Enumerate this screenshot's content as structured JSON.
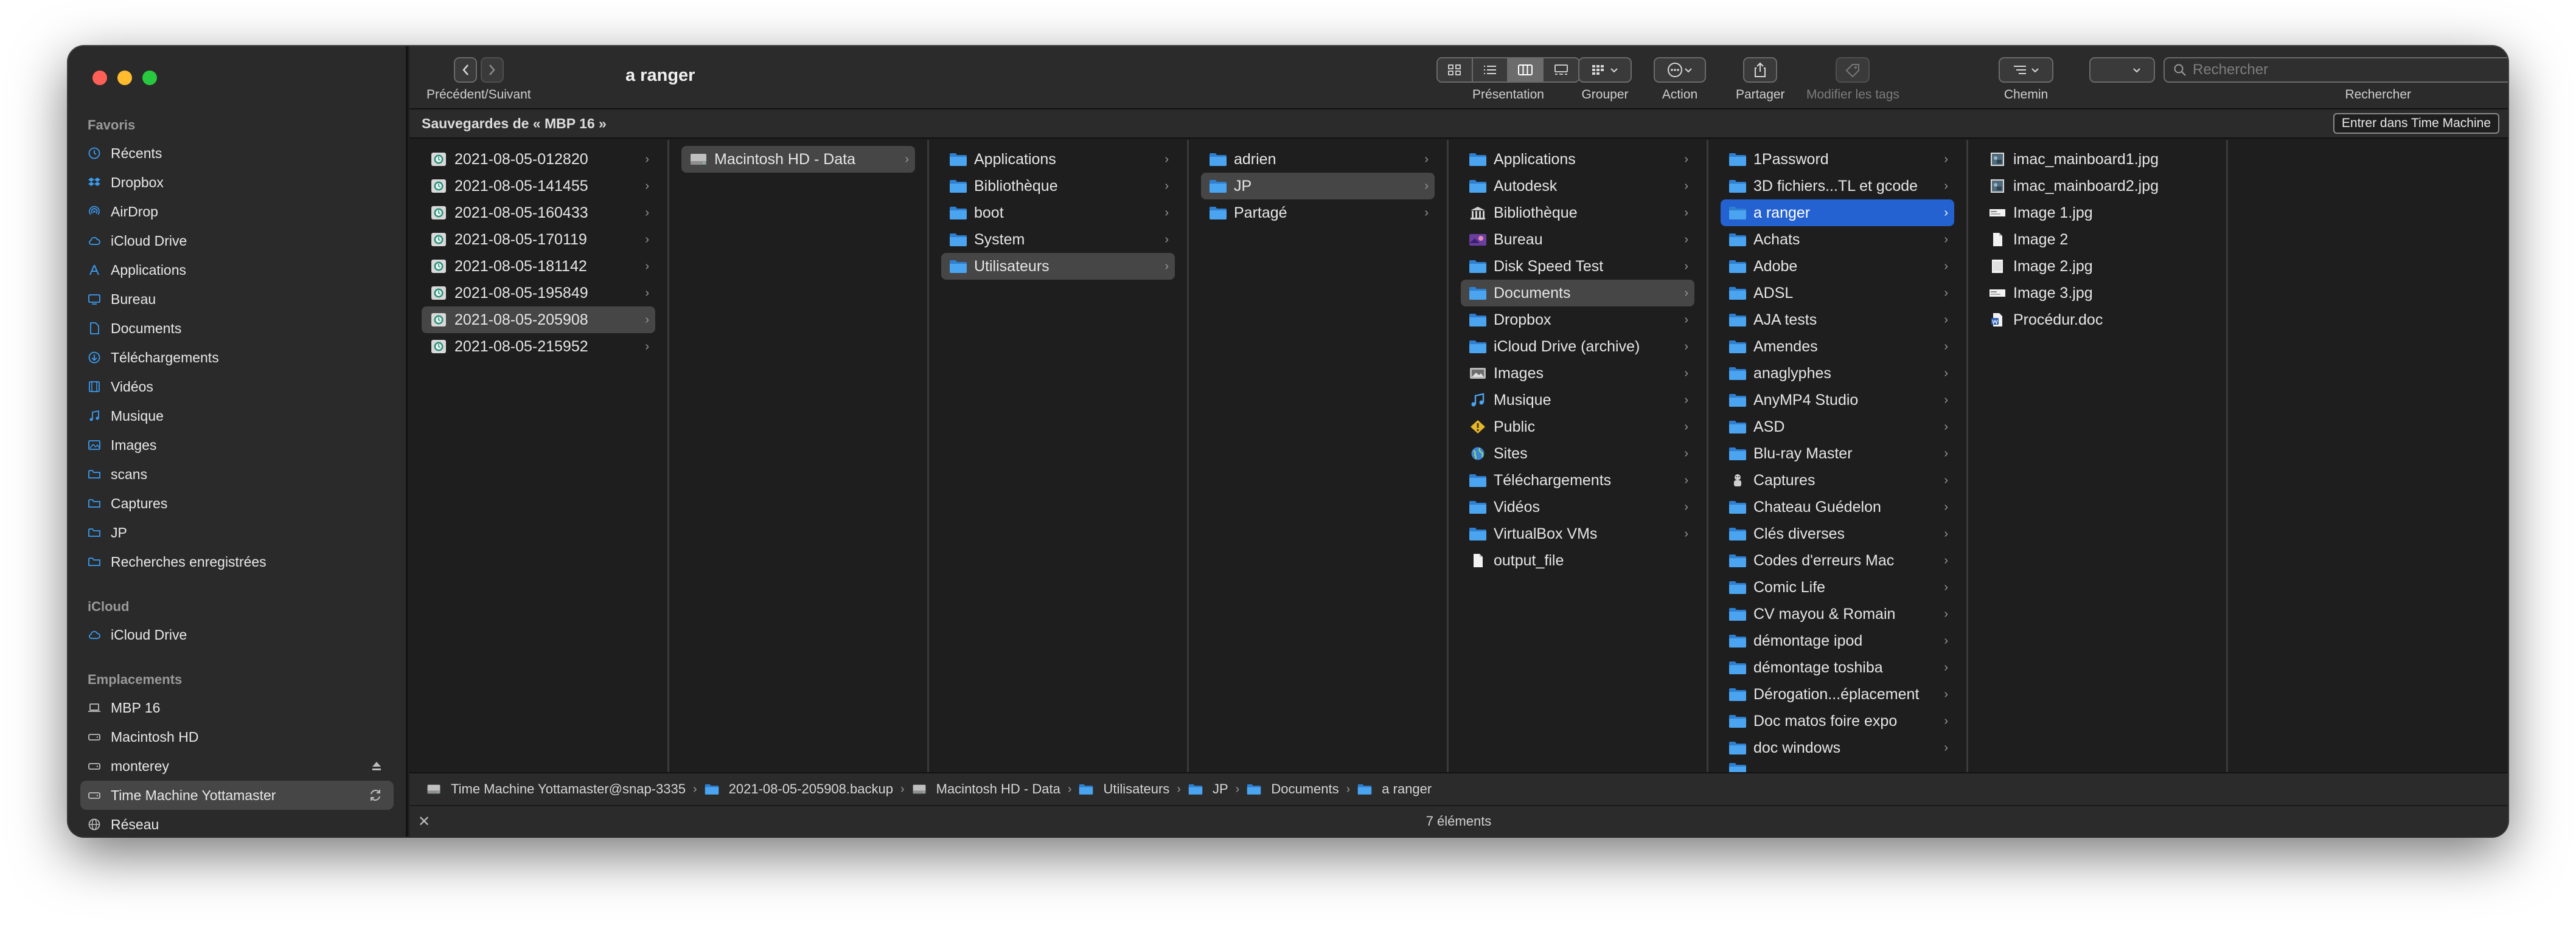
{
  "window": {
    "title": "a ranger"
  },
  "sidebar": {
    "favorites_title": "Favoris",
    "favorites": [
      {
        "label": "Récents",
        "icon": "clock-icon"
      },
      {
        "label": "Dropbox",
        "icon": "dropbox-icon"
      },
      {
        "label": "AirDrop",
        "icon": "airdrop-icon"
      },
      {
        "label": "iCloud Drive",
        "icon": "cloud-icon"
      },
      {
        "label": "Applications",
        "icon": "applications-icon"
      },
      {
        "label": "Bureau",
        "icon": "desktop-icon"
      },
      {
        "label": "Documents",
        "icon": "document-icon"
      },
      {
        "label": "Téléchargements",
        "icon": "download-icon"
      },
      {
        "label": "Vidéos",
        "icon": "film-icon"
      },
      {
        "label": "Musique",
        "icon": "music-icon"
      },
      {
        "label": "Images",
        "icon": "photo-icon"
      },
      {
        "label": "scans",
        "icon": "folder-icon"
      },
      {
        "label": "Captures",
        "icon": "folder-icon"
      },
      {
        "label": "JP",
        "icon": "folder-icon"
      },
      {
        "label": "Recherches enregistrées",
        "icon": "folder-icon"
      }
    ],
    "icloud_title": "iCloud",
    "icloud": [
      {
        "label": "iCloud Drive",
        "icon": "cloud-icon"
      }
    ],
    "locations_title": "Emplacements",
    "locations": [
      {
        "label": "MBP 16",
        "icon": "laptop-icon"
      },
      {
        "label": "Macintosh HD",
        "icon": "drive-icon"
      },
      {
        "label": "monterey",
        "icon": "drive-icon",
        "trail": "eject"
      },
      {
        "label": "Time Machine Yottamaster",
        "icon": "drive-icon",
        "trail": "sync",
        "selected": true
      },
      {
        "label": "Réseau",
        "icon": "globe-icon"
      }
    ]
  },
  "toolbar": {
    "nav_label": "Précédent/Suivant",
    "presentation_label": "Présentation",
    "group_label": "Grouper",
    "action_label": "Action",
    "share_label": "Partager",
    "tags_label": "Modifier les tags",
    "path_label": "Chemin",
    "search_label": "Rechercher",
    "search_placeholder": "Rechercher"
  },
  "backup_bar": {
    "label": "Sauvegardes de « MBP 16 »",
    "enter_button": "Entrer dans Time Machine"
  },
  "columns": [
    [
      {
        "label": "2021-08-05-012820",
        "icon": "tm-backup",
        "chevron": true
      },
      {
        "label": "2021-08-05-141455",
        "icon": "tm-backup",
        "chevron": true
      },
      {
        "label": "2021-08-05-160433",
        "icon": "tm-backup",
        "chevron": true
      },
      {
        "label": "2021-08-05-170119",
        "icon": "tm-backup",
        "chevron": true
      },
      {
        "label": "2021-08-05-181142",
        "icon": "tm-backup",
        "chevron": true
      },
      {
        "label": "2021-08-05-195849",
        "icon": "tm-backup",
        "chevron": true
      },
      {
        "label": "2021-08-05-205908",
        "icon": "tm-backup",
        "chevron": true,
        "sel": "grey"
      },
      {
        "label": "2021-08-05-215952",
        "icon": "tm-backup",
        "chevron": true
      }
    ],
    [
      {
        "label": "Macintosh HD - Data",
        "icon": "disk",
        "chevron": true,
        "sel": "grey"
      }
    ],
    [
      {
        "label": "Applications",
        "icon": "folder",
        "chevron": true
      },
      {
        "label": "Bibliothèque",
        "icon": "folder",
        "chevron": true
      },
      {
        "label": "boot",
        "icon": "folder",
        "chevron": true
      },
      {
        "label": "System",
        "icon": "folder",
        "chevron": true
      },
      {
        "label": "Utilisateurs",
        "icon": "folder",
        "chevron": true,
        "sel": "grey"
      }
    ],
    [
      {
        "label": "adrien",
        "icon": "folder",
        "chevron": true
      },
      {
        "label": "JP",
        "icon": "folder",
        "chevron": true,
        "sel": "grey"
      },
      {
        "label": "Partagé",
        "icon": "folder",
        "chevron": true
      }
    ],
    [
      {
        "label": "Applications",
        "icon": "folder",
        "chevron": true
      },
      {
        "label": "Autodesk",
        "icon": "folder",
        "chevron": true
      },
      {
        "label": "Bibliothèque",
        "icon": "library",
        "chevron": true
      },
      {
        "label": "Bureau",
        "icon": "desktop-folder",
        "chevron": true
      },
      {
        "label": "Disk Speed Test",
        "icon": "folder",
        "chevron": true
      },
      {
        "label": "Documents",
        "icon": "folder",
        "chevron": true,
        "sel": "grey"
      },
      {
        "label": "Dropbox",
        "icon": "folder",
        "chevron": true
      },
      {
        "label": "iCloud Drive (archive)",
        "icon": "folder",
        "chevron": true
      },
      {
        "label": "Images",
        "icon": "images-folder",
        "chevron": true
      },
      {
        "label": "Musique",
        "icon": "music-folder",
        "chevron": true
      },
      {
        "label": "Public",
        "icon": "public",
        "chevron": true
      },
      {
        "label": "Sites",
        "icon": "sites",
        "chevron": true
      },
      {
        "label": "Téléchargements",
        "icon": "folder",
        "chevron": true
      },
      {
        "label": "Vidéos",
        "icon": "folder",
        "chevron": true
      },
      {
        "label": "VirtualBox VMs",
        "icon": "folder",
        "chevron": true
      },
      {
        "label": "output_file",
        "icon": "file",
        "chevron": false
      }
    ],
    [
      {
        "label": "1Password",
        "icon": "folder",
        "chevron": true
      },
      {
        "label": "3D fichiers...TL et gcode",
        "icon": "folder",
        "chevron": true
      },
      {
        "label": "a ranger",
        "icon": "folder",
        "chevron": true,
        "sel": "blue"
      },
      {
        "label": "Achats",
        "icon": "folder",
        "chevron": true
      },
      {
        "label": "Adobe",
        "icon": "folder",
        "chevron": true
      },
      {
        "label": "ADSL",
        "icon": "folder",
        "chevron": true
      },
      {
        "label": "AJA tests",
        "icon": "folder",
        "chevron": true
      },
      {
        "label": "Amendes",
        "icon": "folder",
        "chevron": true
      },
      {
        "label": "anaglyphes",
        "icon": "folder",
        "chevron": true
      },
      {
        "label": "AnyMP4 Studio",
        "icon": "folder",
        "chevron": true
      },
      {
        "label": "ASD",
        "icon": "folder",
        "chevron": true
      },
      {
        "label": "Blu-ray Master",
        "icon": "folder",
        "chevron": true
      },
      {
        "label": "Captures",
        "icon": "captures",
        "chevron": true
      },
      {
        "label": "Chateau Guédelon",
        "icon": "folder",
        "chevron": true
      },
      {
        "label": "Clés diverses",
        "icon": "folder",
        "chevron": true
      },
      {
        "label": "Codes d'erreurs Mac",
        "icon": "folder",
        "chevron": true
      },
      {
        "label": "Comic Life",
        "icon": "folder",
        "chevron": true
      },
      {
        "label": "CV mayou & Romain",
        "icon": "folder",
        "chevron": true
      },
      {
        "label": "démontage ipod",
        "icon": "folder",
        "chevron": true
      },
      {
        "label": "démontage toshiba",
        "icon": "folder",
        "chevron": true
      },
      {
        "label": "Dérogation...éplacement",
        "icon": "folder",
        "chevron": true
      },
      {
        "label": "Doc matos foire expo",
        "icon": "folder",
        "chevron": true
      },
      {
        "label": "doc windows",
        "icon": "folder",
        "chevron": true
      }
    ],
    [
      {
        "label": "imac_mainboard1.jpg",
        "icon": "jpg-thumb",
        "chevron": false
      },
      {
        "label": "imac_mainboard2.jpg",
        "icon": "jpg-thumb",
        "chevron": false
      },
      {
        "label": "Image 1.jpg",
        "icon": "image-white",
        "chevron": false
      },
      {
        "label": "Image 2",
        "icon": "file",
        "chevron": false
      },
      {
        "label": "Image 2.jpg",
        "icon": "file-white",
        "chevron": false
      },
      {
        "label": "Image 3.jpg",
        "icon": "image-white",
        "chevron": false
      },
      {
        "label": "Procédur.doc",
        "icon": "doc",
        "chevron": false
      }
    ]
  ],
  "pathbar": [
    {
      "label": "Time Machine Yottamaster@snap-3335",
      "icon": "disk"
    },
    {
      "label": "2021-08-05-205908.backup",
      "icon": "folder"
    },
    {
      "label": "Macintosh HD - Data",
      "icon": "disk"
    },
    {
      "label": "Utilisateurs",
      "icon": "folder"
    },
    {
      "label": "JP",
      "icon": "folder"
    },
    {
      "label": "Documents",
      "icon": "folder"
    },
    {
      "label": "a ranger",
      "icon": "folder"
    }
  ],
  "status": {
    "count": "7 éléments"
  },
  "colors": {
    "selection_blue": "#2461d1",
    "folder_blue": "#4aa4f0",
    "sidebar_icon": "#3a9cf3"
  }
}
